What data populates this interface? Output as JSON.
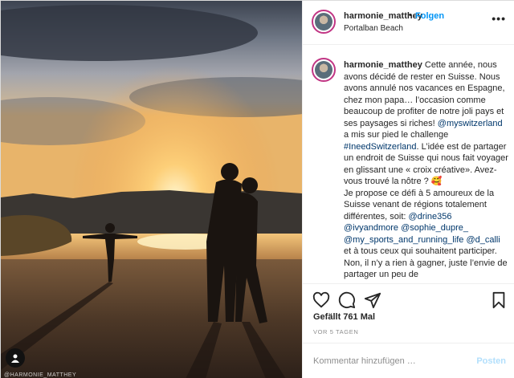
{
  "post": {
    "username": "harmonie_matthey",
    "dot": "•",
    "follow_label": "Folgen",
    "location": "Portalban Beach",
    "more_label": "•••",
    "caption_parts": [
      {
        "text": "Cette année, nous avons décidé de rester en Suisse. Nous avons annulé nos vacances en Espagne, chez mon papa… l’occasion comme beaucoup de profiter de notre joli pays et ses paysages si riches! ",
        "link": false
      },
      {
        "text": "@myswitzerland",
        "link": true
      },
      {
        "text": " a mis sur pied le challenge ",
        "link": false
      },
      {
        "text": "#IneedSwitzerland",
        "link": true
      },
      {
        "text": ". L’idée est de partager un endroit de Suisse qui nous fait voyager en glissant une « croix créative». Avez-vous trouvé la nôtre ? 🥰",
        "link": false
      },
      {
        "text": "\nJe propose ce défi à 5 amoureux de la Suisse venant de régions totalement différentes, soit: ",
        "link": false
      },
      {
        "text": "@drine356",
        "link": true
      },
      {
        "text": " ",
        "link": false
      },
      {
        "text": "@ivyandmore",
        "link": true
      },
      {
        "text": " ",
        "link": false
      },
      {
        "text": "@sophie_dupre_",
        "link": true
      },
      {
        "text": " ",
        "link": false
      },
      {
        "text": "@my_sports_and_running_life",
        "link": true
      },
      {
        "text": " ",
        "link": false
      },
      {
        "text": "@d_calli",
        "link": true
      },
      {
        "text": " et à tous ceux qui souhaitent participer. Non, il n’y a rien à gagner, juste l’envie de partager un peu de",
        "link": false
      }
    ],
    "likes": "Gefällt 761 Mal",
    "timestamp": "VOR 5 TAGEN",
    "comment_placeholder": "Kommentar hinzufügen …",
    "post_label": "Posten",
    "watermark": "@HARMONIE_MATTHEY"
  },
  "colors": {
    "accent": "#0095f6",
    "link": "#00376b",
    "muted": "#8e8e8e",
    "post_disabled": "#b2dffc"
  },
  "icons": [
    "heart-icon",
    "comment-icon",
    "share-icon",
    "bookmark-icon",
    "user-tag-icon",
    "more-icon"
  ]
}
